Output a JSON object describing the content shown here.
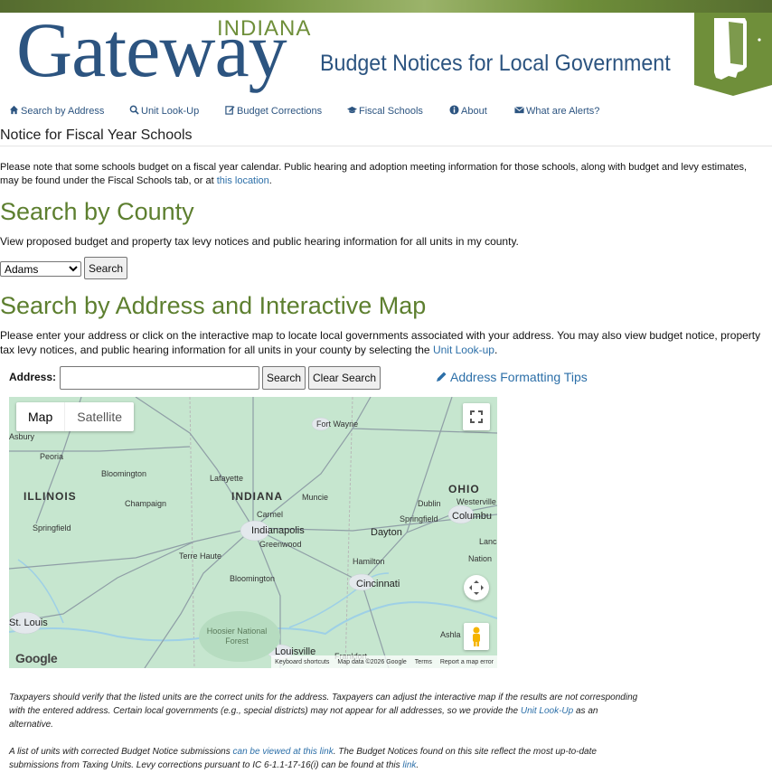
{
  "header": {
    "logo_state": "INDIANA",
    "logo_name": "Gateway",
    "subtitle": "Budget Notices for Local Government"
  },
  "nav": {
    "items": [
      {
        "label": "Search by Address",
        "icon": "home-icon"
      },
      {
        "label": "Unit Look-Up",
        "icon": "search-icon"
      },
      {
        "label": "Budget Corrections",
        "icon": "edit-icon"
      },
      {
        "label": "Fiscal Schools",
        "icon": "graduation-cap-icon"
      },
      {
        "label": "About",
        "icon": "info-icon"
      },
      {
        "label": "What are Alerts?",
        "icon": "envelope-icon"
      }
    ]
  },
  "notice": {
    "heading": "Notice for Fiscal Year Schools",
    "text_before": "Please note that some schools budget on a fiscal year calendar. Public hearing and adoption meeting information for those schools, along with budget and levy estimates, may be found under the Fiscal Schools tab, or at ",
    "link": "this location",
    "text_after": "."
  },
  "county_search": {
    "heading": "Search by County",
    "description": "View proposed budget and property tax levy notices and public hearing information for all units in my county.",
    "selected_county": "Adams",
    "button": "Search"
  },
  "address_search": {
    "heading": "Search by Address and Interactive Map",
    "text_before": "Please enter your address or click on the interactive map to locate local governments associated with your address. You may also view budget notice, property tax levy notices, and public hearing information for all units in your county by selecting the ",
    "link": "Unit Look-up",
    "text_after": ".",
    "address_label": "Address:",
    "address_value": "",
    "search_button": "Search",
    "clear_button": "Clear Search",
    "tips_link": "Address Formatting Tips"
  },
  "map": {
    "type_map": "Map",
    "type_satellite": "Satellite",
    "states": [
      "ILLINOIS",
      "INDIANA",
      "OHIO"
    ],
    "cities": [
      "Fort Wayne",
      "Peoria",
      "Bloomington",
      "Lafayette",
      "Champaign",
      "Muncie",
      "Carmel",
      "Indianapolis",
      "Greenwood",
      "Springfield",
      "Dublin",
      "Westerville",
      "Springfield",
      "Columbu",
      "Dayton",
      "Terre Haute",
      "Bloomington",
      "Hamilton",
      "Cincinnati",
      "St. Louis",
      "Hoosier National Forest",
      "Louisville",
      "Frankfort",
      "Asbury",
      "Lanca",
      "Nation",
      "Ashla"
    ],
    "footer": {
      "shortcuts": "Keyboard shortcuts",
      "data": "Map data ©2026 Google",
      "terms": "Terms",
      "report": "Report a map error"
    },
    "google": "Google"
  },
  "footnotes": {
    "p1_before": "Taxpayers should verify that the listed units are the correct units for the address. Taxpayers can adjust the interactive map if the results are not corresponding with the entered address. Certain local governments (e.g., special districts) may not appear for all addresses, so we provide the ",
    "p1_link": "Unit Look-Up",
    "p1_after": " as an alternative.",
    "p2_before": "A list of units with corrected Budget Notice submissions ",
    "p2_link1": "can be viewed at this link",
    "p2_mid": ". The Budget Notices found on this site reflect the most up-to-date submissions from Taxing Units. Levy corrections pursuant to IC 6-1.1-17-16(i) can be found at this ",
    "p2_link2": "link",
    "p2_after": "."
  },
  "colors": {
    "brand_blue": "#2c5480",
    "brand_green": "#5d7f2f",
    "link": "#2c6fa8"
  }
}
